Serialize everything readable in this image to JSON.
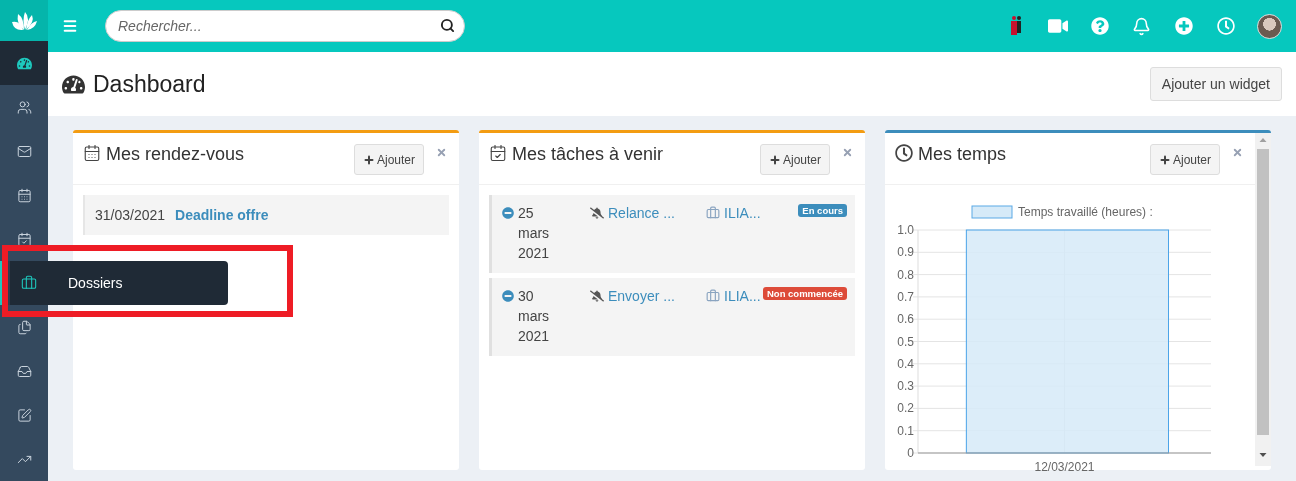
{
  "topbar": {
    "search": {
      "placeholder": "Rechercher..."
    }
  },
  "sidebar": {
    "items": [
      {
        "selected": true
      },
      {
        "selected": false
      },
      {
        "selected": false
      },
      {
        "selected": false
      },
      {
        "selected": false
      },
      {
        "selected": false,
        "tooltip": "Dossiers",
        "highlighted": true
      },
      {
        "selected": false
      },
      {
        "selected": false
      },
      {
        "selected": false
      },
      {
        "selected": false
      }
    ]
  },
  "header": {
    "title": "Dashboard",
    "button": "Ajouter un widget"
  },
  "widgets": [
    {
      "kind": "appointments",
      "title": "Mes rendez-vous",
      "color": "#f39c12",
      "add_button": "Ajouter",
      "items": [
        {
          "date": "31/03/2021",
          "title": "Deadline offre"
        }
      ]
    },
    {
      "kind": "tasks",
      "title": "Mes tâches à venir",
      "color": "#f39c12",
      "add_button": "Ajouter",
      "items": [
        {
          "date": "25 mars 2021",
          "title": "Relance ...",
          "project": "ILIA...",
          "status": "En cours",
          "color": "#3c8dbc"
        },
        {
          "date": "30 mars 2021",
          "title": "Envoyer ...",
          "project": "ILIA...",
          "status": "Non commencée",
          "color": "#dd4b39"
        }
      ]
    },
    {
      "kind": "chart",
      "title": "Mes temps",
      "color": "#3c8dbc",
      "add_button": "Ajouter",
      "chart_data": {
        "type": "bar",
        "categories": [
          "12/03/2021"
        ],
        "series": [
          {
            "name": "Temps travaillé (heures) :",
            "color": "#d6eaf8",
            "values": [
              1
            ]
          }
        ],
        "grid": true,
        "ylim": [
          0,
          1
        ],
        "yticks": [
          0,
          0.1,
          0.2,
          0.3,
          0.4,
          0.5,
          0.6,
          0.7,
          0.8,
          0.9,
          {
            "value": 1,
            "label": "1.0"
          }
        ]
      }
    }
  ]
}
